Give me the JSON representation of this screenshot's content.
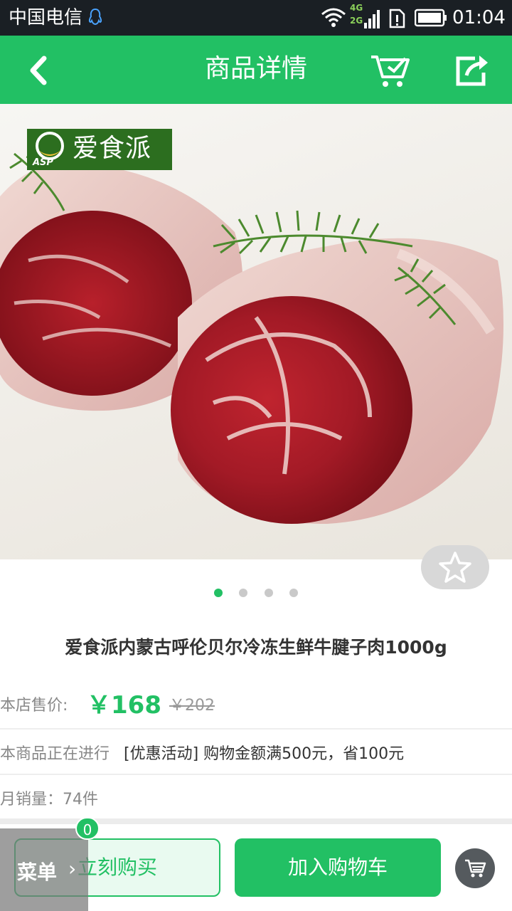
{
  "status_bar": {
    "carrier": "中国电信",
    "network_top": "4G",
    "network_bottom": "2G",
    "time": "01:04"
  },
  "header": {
    "title": "商品详情",
    "icons": [
      "back-arrow-icon",
      "cart-icon",
      "share-icon"
    ]
  },
  "product": {
    "brand_logo_text": "爱食派",
    "brand_logo_sub": "ASP",
    "image_count": 4,
    "active_image_index": 0,
    "title": "爱食派内蒙古呼伦贝尔冷冻生鲜牛腱子肉1000g",
    "price_label": "本店售价:",
    "price": "￥168",
    "original_price": "￥202",
    "promo_label": "本商品正在进行",
    "promo_text": "[优惠活动] 购物金额满500元，省100元",
    "monthly_sales": "月销量：74件"
  },
  "bottom_bar": {
    "buy_now": "立刻购买",
    "add_to_cart": "加入购物车",
    "menu_label": "菜单",
    "menu_chevron": "›",
    "cart_count": "0"
  },
  "colors": {
    "brand_green": "#22c064",
    "status_bar": "#1a1f24"
  }
}
